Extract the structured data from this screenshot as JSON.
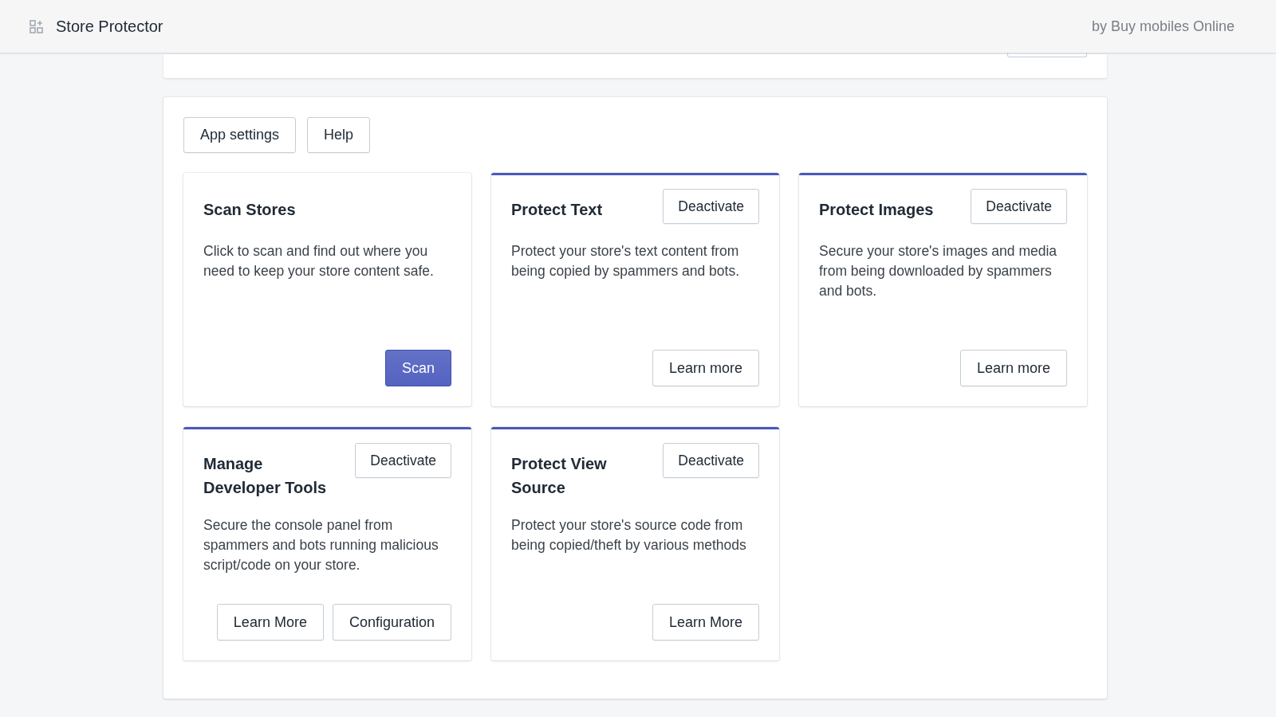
{
  "header": {
    "title": "Store Protector",
    "byline": "by Buy mobiles Online"
  },
  "toolbar": {
    "buttons": [
      "App settings",
      "Help"
    ]
  },
  "cards": [
    {
      "title": "Scan Stores",
      "active": false,
      "description": "Click to scan and find out where you need to keep your store content safe.",
      "buttons": [
        {
          "label": "Scan",
          "kind": "primary"
        }
      ]
    },
    {
      "title": "Protect Text",
      "active": true,
      "header_button": "Deactivate",
      "description": "Protect your store's text content from being copied by spammers and bots.",
      "buttons": [
        {
          "label": "Learn more",
          "kind": "secondary"
        }
      ]
    },
    {
      "title": "Protect Images",
      "active": true,
      "header_button": "Deactivate",
      "description": "Secure your store's images and media from being downloaded by spammers and bots.",
      "buttons": [
        {
          "label": "Learn more",
          "kind": "secondary"
        }
      ]
    },
    {
      "title": "Manage Developer Tools",
      "active": true,
      "header_button": "Deactivate",
      "description": "Secure the console panel from spammers and bots running malicious script/code on your store.",
      "buttons": [
        {
          "label": "Learn More",
          "kind": "secondary"
        },
        {
          "label": "Configuration",
          "kind": "secondary"
        }
      ]
    },
    {
      "title": "Protect View Source",
      "active": true,
      "header_button": "Deactivate",
      "description": "Protect your store's source code from being copied/theft by various methods",
      "buttons": [
        {
          "label": "Learn More",
          "kind": "secondary"
        }
      ]
    }
  ]
}
